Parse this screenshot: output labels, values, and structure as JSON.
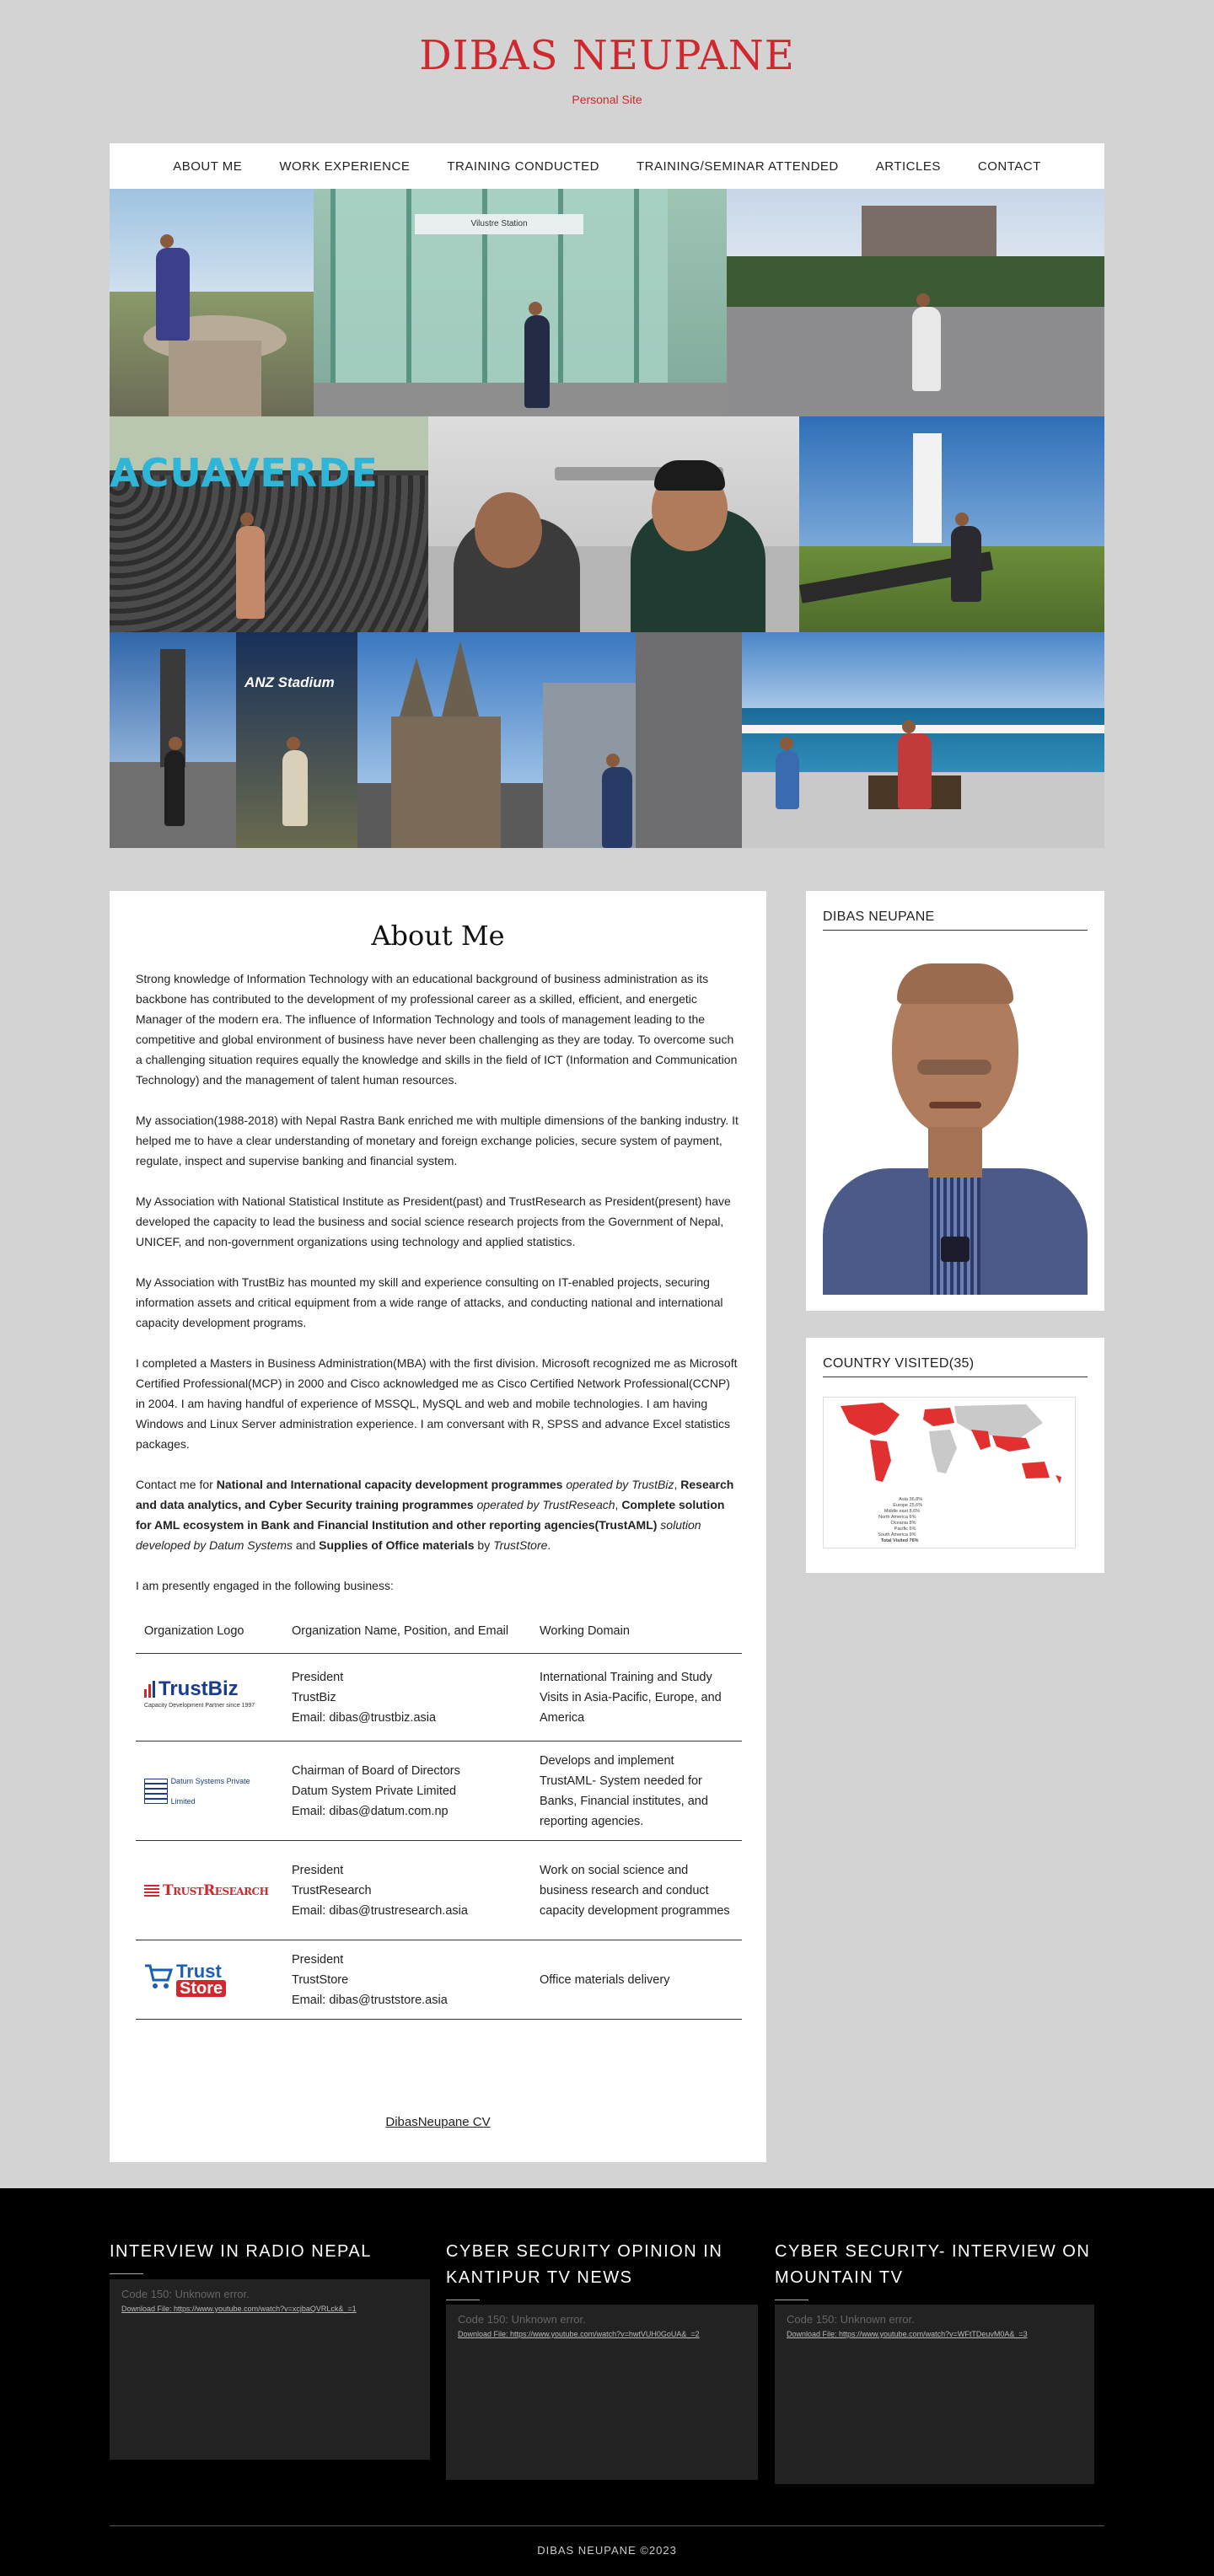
{
  "site": {
    "title": "DIBAS NEUPANE",
    "tagline": "Personal Site"
  },
  "nav": [
    "ABOUT ME",
    "WORK EXPERIENCE",
    "TRAINING CONDUCTED",
    "TRAINING/SEMINAR ATTENDED",
    "ARTICLES",
    "CONTACT"
  ],
  "gallery": {
    "station_sign": "Vilustre Station",
    "park_sign": "ACUAVERDE",
    "stadium_sign": "ANZ Stadium"
  },
  "about": {
    "heading": "About Me",
    "paragraphs": [
      "Strong knowledge of Information Technology with an educational background of business administration as its backbone has contributed to the development of my professional career as a skilled, efficient, and energetic Manager of the modern era. The influence of Information Technology and tools of management leading to the competitive and global environment of business have never been challenging as they are today. To overcome such a challenging situation requires equally the knowledge and skills in the field of ICT (Information and Communication Technology) and the management of talent human resources.",
      "My association(1988-2018) with Nepal Rastra Bank enriched me with multiple dimensions of the banking industry. It helped me to have a clear understanding of monetary and foreign exchange policies, secure system of payment, regulate, inspect and supervise banking and financial system.",
      "My Association with National Statistical Institute as President(past) and TrustResearch as President(present) have developed the capacity to lead the business and social science research projects from the Government of Nepal, UNICEF, and non-government organizations using technology and applied statistics.",
      "My Association with TrustBiz has mounted my skill and experience consulting on IT-enabled projects, securing information assets and critical equipment from a wide range of attacks, and conducting national and international capacity development programs.",
      "I completed a Masters in Business Administration(MBA) with the first division. Microsoft recognized me as Microsoft Certified Professional(MCP) in 2000 and Cisco acknowledged me as Cisco Certified Network Professional(CCNP) in 2004. I am having handful of experience of MSSQL, MySQL and web and mobile technologies. I am having Windows and Linux Server administration experience. I am conversant with R, SPSS and advance Excel statistics packages."
    ],
    "contact": {
      "lead": "Contact me for ",
      "b1": "National and International capacity development programmes",
      "i1": " operated by TrustBiz",
      "sep1": ", ",
      "b2": "Research and data analytics, and Cyber Security training programmes",
      "i2": " operated by TrustReseach",
      "sep2": ", ",
      "b3": "Complete solution for AML ecosystem in Bank and Financial Institution and other reporting agencies(TrustAML)",
      "i3": " solution developed by Datum Systems",
      "and": " and ",
      "b4": "Supplies of Office materials",
      "by": " by ",
      "i4": "TrustStore",
      "end": "."
    },
    "engaged": "I am presently engaged in the following business:",
    "table_headers": [
      "Organization Logo",
      "Organization Name, Position, and Email",
      "Working  Domain"
    ],
    "rows": [
      {
        "logo": "TrustBiz",
        "logo_sub": "Capacity Development Partner since 1997",
        "lines": [
          "President",
          "TrustBiz",
          "Email: dibas@trustbiz.asia"
        ],
        "domain": "International  Training and Study Visits in Asia-Pacific, Europe, and America"
      },
      {
        "logo": "Datum Systems Private Limited",
        "lines": [
          "Chairman of Board of Directors",
          "Datum System Private Limited",
          "Email: dibas@datum.com.np"
        ],
        "domain": "Develops and implement TrustAML- System needed for Banks, Financial institutes, and reporting agencies."
      },
      {
        "logo": "TrustResearch",
        "lines": [
          "President",
          "TrustResearch",
          "Email: dibas@trustresearch.asia"
        ],
        "domain": "Work on social science and business research and conduct capacity development programmes"
      },
      {
        "logo_top": "Trust",
        "logo_bottom": "Store",
        "lines": [
          "President",
          "TrustStore",
          "Email: dibas@truststore.asia"
        ],
        "domain": "Office materials delivery"
      }
    ],
    "cv_link": "DibasNeupane CV"
  },
  "sidebar": {
    "profile_title": "DIBAS NEUPANE",
    "countries_title": "COUNTRY VISITED(35)",
    "map_legend": [
      [
        "Asia",
        "36.8%"
      ],
      [
        "Europe",
        "25.6%"
      ],
      [
        "Middle east",
        "8.6%"
      ],
      [
        "North America",
        "6%"
      ],
      [
        "Oceania",
        "8%"
      ],
      [
        "Pacific",
        "6%"
      ],
      [
        "South America",
        "9%"
      ],
      [
        "Total Visited",
        "76%"
      ]
    ]
  },
  "footer": {
    "widgets": [
      {
        "title": "INTERVIEW IN RADIO NEPAL",
        "error": "Code 150: Unknown error.",
        "link": "Download File: https://www.youtube.com/watch?v=xcjbaQVRLck&_=1"
      },
      {
        "title": "CYBER SECURITY OPINION IN KANTIPUR TV NEWS",
        "error": "Code 150: Unknown error.",
        "link": "Download File: https://www.youtube.com/watch?v=hwtVUH0GoUA&_=2"
      },
      {
        "title": "CYBER SECURITY- INTERVIEW ON MOUNTAIN TV",
        "error": "Code 150: Unknown error.",
        "link": "Download File: https://www.youtube.com/watch?v=WFtTDeuvM0A&_=3"
      }
    ],
    "copyright": "DIBAS NEUPANE ©2023"
  },
  "colors": {
    "brand_red": "#d0282e",
    "page_bg": "#d3d3d3",
    "footer_bg": "#000000",
    "video_bg": "#222222"
  }
}
